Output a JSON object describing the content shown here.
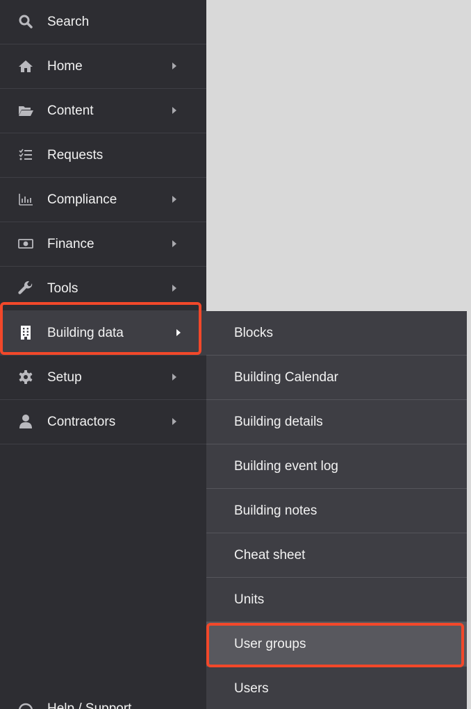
{
  "sidebar": {
    "items": [
      {
        "label": "Search",
        "icon": "search-icon",
        "has_arrow": false
      },
      {
        "label": "Home",
        "icon": "home-icon",
        "has_arrow": true
      },
      {
        "label": "Content",
        "icon": "folder-open-icon",
        "has_arrow": true
      },
      {
        "label": "Requests",
        "icon": "checklist-icon",
        "has_arrow": false
      },
      {
        "label": "Compliance",
        "icon": "bar-chart-icon",
        "has_arrow": true
      },
      {
        "label": "Finance",
        "icon": "banknote-icon",
        "has_arrow": true
      },
      {
        "label": "Tools",
        "icon": "wrench-icon",
        "has_arrow": true
      },
      {
        "label": "Building data",
        "icon": "building-icon",
        "has_arrow": true,
        "active": true
      },
      {
        "label": "Setup",
        "icon": "gear-icon",
        "has_arrow": true
      },
      {
        "label": "Contractors",
        "icon": "user-icon",
        "has_arrow": true
      }
    ],
    "help_label": "Help / Support"
  },
  "submenu": {
    "parent": "Building data",
    "items": [
      {
        "label": "Blocks"
      },
      {
        "label": "Building Calendar"
      },
      {
        "label": "Building details"
      },
      {
        "label": "Building event log"
      },
      {
        "label": "Building notes"
      },
      {
        "label": "Cheat sheet"
      },
      {
        "label": "Units"
      },
      {
        "label": "User groups",
        "selected": true
      },
      {
        "label": "Users"
      }
    ]
  },
  "colors": {
    "sidebar_bg": "#2d2d32",
    "submenu_bg": "#3e3e44",
    "selected_bg": "#58585e",
    "highlight": "#f2482a",
    "content_bg": "#d9d9d9"
  }
}
